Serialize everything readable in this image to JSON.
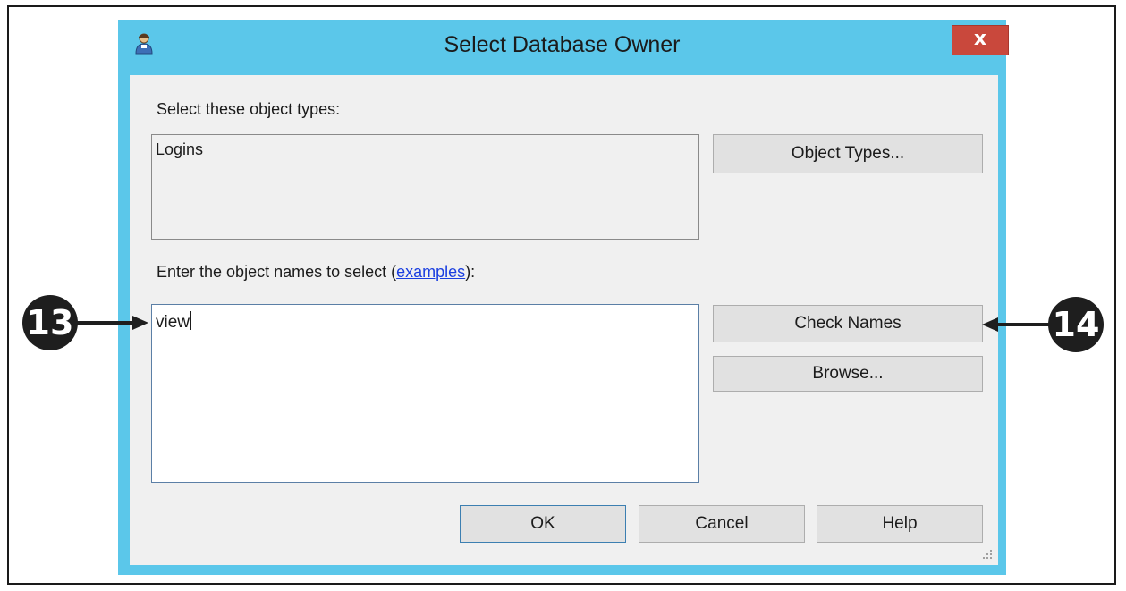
{
  "window": {
    "title": "Select Database Owner",
    "close_label": "x"
  },
  "object_types": {
    "label": "Select these object types:",
    "value": "Logins",
    "button_label": "Object Types..."
  },
  "object_names": {
    "label_prefix": "Enter the object names to select (",
    "examples_link": "examples",
    "label_suffix": "):",
    "value": "view"
  },
  "buttons": {
    "check_names": "Check Names",
    "browse": "Browse...",
    "ok": "OK",
    "cancel": "Cancel",
    "help": "Help"
  },
  "callouts": {
    "left": "13",
    "right": "14"
  },
  "colors": {
    "window_border": "#5bc7ea",
    "close_button": "#c9483c",
    "link": "#1a3ee0",
    "callout": "#1e1e1e"
  }
}
